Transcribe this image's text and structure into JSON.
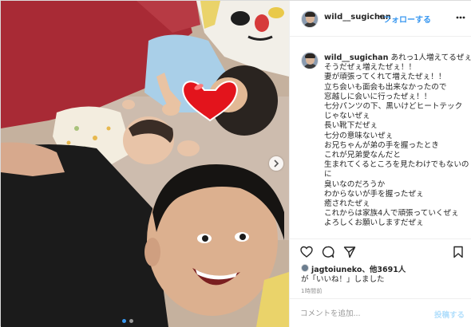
{
  "photo": {
    "alt": "",
    "carousel_count": 2,
    "carousel_active_index": 1
  },
  "header": {
    "username": "wild__sugichan",
    "separator": "•",
    "follow_label": "フォローする",
    "more_icon": "more-horizontal-icon"
  },
  "caption": {
    "username": "wild__sugichan",
    "lines": [
      "あれっ1人増えてるぜぇ！！",
      "そうだぜぇ増えたぜぇ！！",
      "妻が頑張ってくれて増えたぜぇ！！",
      "立ち会いも面会も出来なかったので",
      "窓越しに会いに行ったぜぇ！！",
      "七分パンツの下、黒いけどヒートテック",
      "じゃないぜぇ",
      "長い靴下だぜぇ",
      "七分の意味ないぜぇ",
      "お兄ちゃんが弟の手を握ったとき",
      "これが兄弟愛なんだと",
      "生まれてくるところを見たわけでもないの",
      "に",
      "臭いなのだろうか",
      "わからないが手を握ったぜぇ",
      "癒されたぜぇ",
      "これからは家族4人で頑張っていくぜぇ",
      "よろしくお願いしますだぜぇ"
    ]
  },
  "actions": {
    "like_icon": "heart-icon",
    "comment_icon": "comment-icon",
    "share_icon": "share-icon",
    "save_icon": "bookmark-icon"
  },
  "likes": {
    "liker": "jagtoiuneko",
    "others": "、他3691人",
    "suffix": "が「いいね！」しました"
  },
  "timestamp": "1時間前",
  "comment": {
    "placeholder": "コメントを追加...",
    "post_label": "投稿する"
  },
  "colors": {
    "accent": "#3897f0",
    "post_disabled": "#b2dffc",
    "muted": "#8e8e8e"
  }
}
